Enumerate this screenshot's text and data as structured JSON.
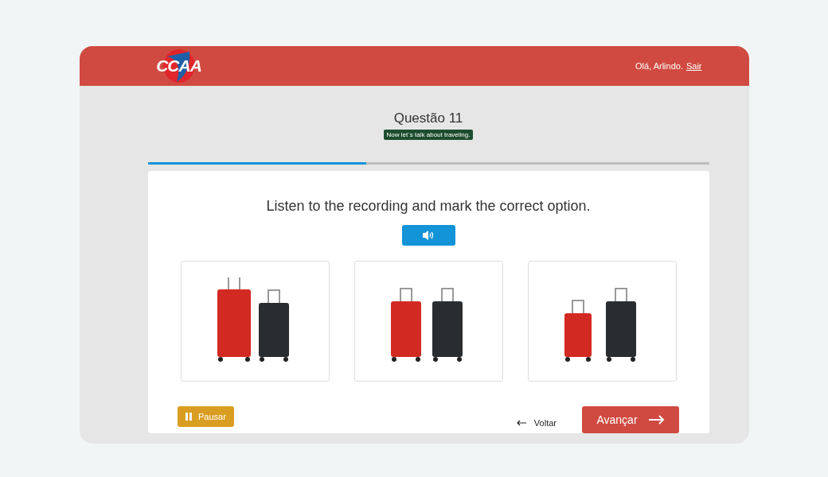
{
  "header": {
    "greeting": "Olá, Arlindo.",
    "logout_link": "Sair",
    "logo": "CCAA"
  },
  "question": {
    "title": "Questão 11",
    "topic": "Now let´s talk about traveling.",
    "progress": {
      "level": 0.39
    }
  },
  "card": {
    "instruction": "Listen to the recording and mark the correct option.",
    "options": [
      {
        "kind": "big-small"
      },
      {
        "kind": "equal"
      },
      {
        "kind": "small-big"
      }
    ]
  },
  "footer": {
    "pause_button": "Pausar",
    "back_link": "Voltar",
    "next_button": "Avançar"
  }
}
